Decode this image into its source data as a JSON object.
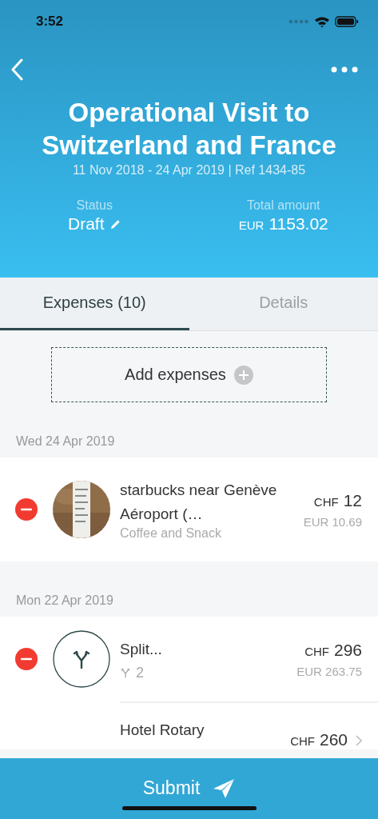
{
  "status_bar": {
    "time": "3:52"
  },
  "header": {
    "title": "Operational Visit to Switzerland and France",
    "subtitle": "11 Nov 2018 - 24 Apr 2019 | Ref 1434-85",
    "status": {
      "label": "Status",
      "value": "Draft"
    },
    "total": {
      "label": "Total amount",
      "currency": "EUR",
      "value": "1153.02"
    }
  },
  "tabs": [
    {
      "label": "Expenses (10)",
      "selected": true
    },
    {
      "label": "Details",
      "selected": false
    }
  ],
  "add_button": {
    "label": "Add expenses"
  },
  "groups": [
    {
      "date": "Wed 24 Apr 2019",
      "items": [
        {
          "kind": "receipt",
          "removable": true,
          "title": "starbucks near Genève Aéroport (…",
          "subtitle": "Coffee and Snack",
          "currency": "CHF",
          "amount": "12",
          "converted": "EUR 10.69"
        }
      ]
    },
    {
      "date": "Mon 22 Apr 2019",
      "items": [
        {
          "kind": "split",
          "removable": true,
          "title": "Split...",
          "split_count": "2",
          "currency": "CHF",
          "amount": "296",
          "converted": "EUR 263.75",
          "children": [
            {
              "kind": "plain",
              "removable": false,
              "title": "Hotel Rotary",
              "currency": "CHF",
              "amount": "260",
              "chevron": true
            }
          ]
        }
      ]
    }
  ],
  "submit_button": {
    "label": "Submit"
  }
}
